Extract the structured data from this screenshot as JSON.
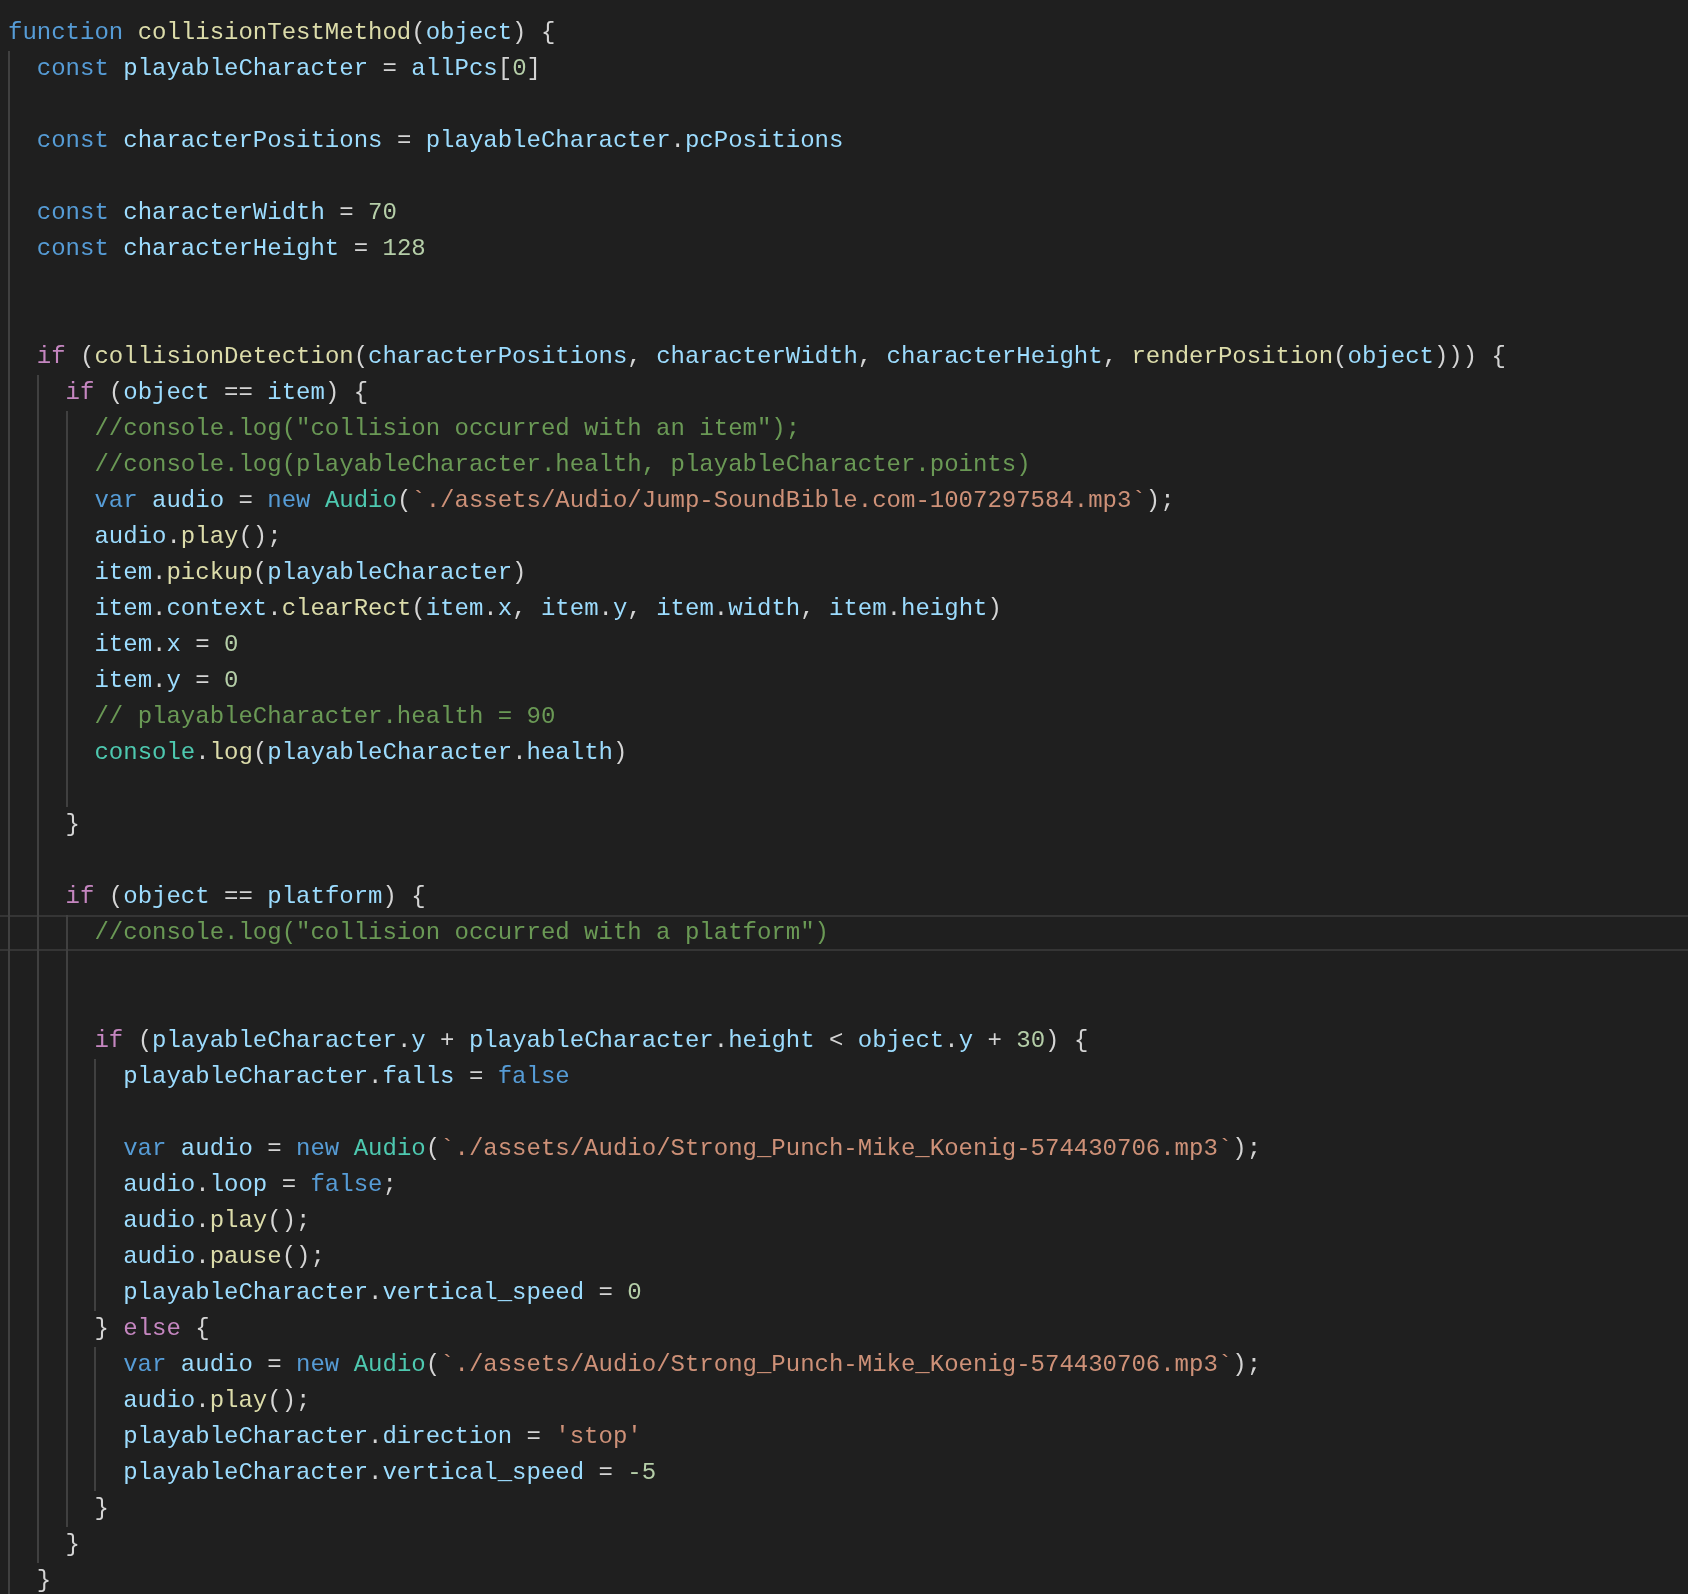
{
  "editor": {
    "lines": [
      {
        "current": false,
        "tokens": [
          {
            "kind": "keyword",
            "text": "function "
          },
          {
            "kind": "function",
            "text": "collisionTestMethod"
          },
          {
            "kind": "punctuation",
            "text": "("
          },
          {
            "kind": "variable",
            "text": "object"
          },
          {
            "kind": "punctuation",
            "text": ") {"
          }
        ]
      },
      {
        "current": false,
        "tokens": [
          {
            "kind": "keyword",
            "text": "  const "
          },
          {
            "kind": "variable",
            "text": "playableCharacter"
          },
          {
            "kind": "punctuation",
            "text": " = "
          },
          {
            "kind": "variable",
            "text": "allPcs"
          },
          {
            "kind": "punctuation",
            "text": "["
          },
          {
            "kind": "number",
            "text": "0"
          },
          {
            "kind": "punctuation",
            "text": "]"
          }
        ]
      },
      {
        "current": false
      },
      {
        "current": false,
        "tokens": [
          {
            "kind": "keyword",
            "text": "  const "
          },
          {
            "kind": "variable",
            "text": "characterPositions"
          },
          {
            "kind": "punctuation",
            "text": " = "
          },
          {
            "kind": "variable",
            "text": "playableCharacter"
          },
          {
            "kind": "punctuation",
            "text": "."
          },
          {
            "kind": "variable",
            "text": "pcPositions"
          }
        ]
      },
      {
        "current": false
      },
      {
        "current": false,
        "tokens": [
          {
            "kind": "keyword",
            "text": "  const "
          },
          {
            "kind": "variable",
            "text": "characterWidth"
          },
          {
            "kind": "punctuation",
            "text": " = "
          },
          {
            "kind": "number",
            "text": "70"
          }
        ]
      },
      {
        "current": false,
        "tokens": [
          {
            "kind": "keyword",
            "text": "  const "
          },
          {
            "kind": "variable",
            "text": "characterHeight"
          },
          {
            "kind": "punctuation",
            "text": " = "
          },
          {
            "kind": "number",
            "text": "128"
          }
        ]
      },
      {
        "current": false
      },
      {
        "current": false
      },
      {
        "current": false,
        "tokens": [
          {
            "kind": "control",
            "text": "  if"
          },
          {
            "kind": "punctuation",
            "text": " ("
          },
          {
            "kind": "function",
            "text": "collisionDetection"
          },
          {
            "kind": "punctuation",
            "text": "("
          },
          {
            "kind": "variable",
            "text": "characterPositions"
          },
          {
            "kind": "punctuation",
            "text": ", "
          },
          {
            "kind": "variable",
            "text": "characterWidth"
          },
          {
            "kind": "punctuation",
            "text": ", "
          },
          {
            "kind": "variable",
            "text": "characterHeight"
          },
          {
            "kind": "punctuation",
            "text": ", "
          },
          {
            "kind": "function",
            "text": "renderPosition"
          },
          {
            "kind": "punctuation",
            "text": "("
          },
          {
            "kind": "variable",
            "text": "object"
          },
          {
            "kind": "punctuation",
            "text": "))) {"
          }
        ]
      },
      {
        "current": false,
        "tokens": [
          {
            "kind": "control",
            "text": "    if"
          },
          {
            "kind": "punctuation",
            "text": " ("
          },
          {
            "kind": "variable",
            "text": "object"
          },
          {
            "kind": "punctuation",
            "text": " == "
          },
          {
            "kind": "variable",
            "text": "item"
          },
          {
            "kind": "punctuation",
            "text": ") {"
          }
        ]
      },
      {
        "current": false,
        "tokens": [
          {
            "kind": "comment",
            "text": "      //console.log(\"collision occurred with an item\");"
          }
        ]
      },
      {
        "current": false,
        "tokens": [
          {
            "kind": "comment",
            "text": "      //console.log(playableCharacter.health, playableCharacter.points)"
          }
        ]
      },
      {
        "current": false,
        "tokens": [
          {
            "kind": "keyword",
            "text": "      var "
          },
          {
            "kind": "variable",
            "text": "audio"
          },
          {
            "kind": "punctuation",
            "text": " = "
          },
          {
            "kind": "keyword",
            "text": "new "
          },
          {
            "kind": "class",
            "text": "Audio"
          },
          {
            "kind": "punctuation",
            "text": "("
          },
          {
            "kind": "string",
            "text": "`./assets/Audio/Jump-SoundBible.com-1007297584.mp3`"
          },
          {
            "kind": "punctuation",
            "text": ");"
          }
        ]
      },
      {
        "current": false,
        "tokens": [
          {
            "kind": "variable",
            "text": "      audio"
          },
          {
            "kind": "punctuation",
            "text": "."
          },
          {
            "kind": "function",
            "text": "play"
          },
          {
            "kind": "punctuation",
            "text": "();"
          }
        ]
      },
      {
        "current": false,
        "tokens": [
          {
            "kind": "variable",
            "text": "      item"
          },
          {
            "kind": "punctuation",
            "text": "."
          },
          {
            "kind": "function",
            "text": "pickup"
          },
          {
            "kind": "punctuation",
            "text": "("
          },
          {
            "kind": "variable",
            "text": "playableCharacter"
          },
          {
            "kind": "punctuation",
            "text": ")"
          }
        ]
      },
      {
        "current": false,
        "tokens": [
          {
            "kind": "variable",
            "text": "      item"
          },
          {
            "kind": "punctuation",
            "text": "."
          },
          {
            "kind": "variable",
            "text": "context"
          },
          {
            "kind": "punctuation",
            "text": "."
          },
          {
            "kind": "function",
            "text": "clearRect"
          },
          {
            "kind": "punctuation",
            "text": "("
          },
          {
            "kind": "variable",
            "text": "item"
          },
          {
            "kind": "punctuation",
            "text": "."
          },
          {
            "kind": "variable",
            "text": "x"
          },
          {
            "kind": "punctuation",
            "text": ", "
          },
          {
            "kind": "variable",
            "text": "item"
          },
          {
            "kind": "punctuation",
            "text": "."
          },
          {
            "kind": "variable",
            "text": "y"
          },
          {
            "kind": "punctuation",
            "text": ", "
          },
          {
            "kind": "variable",
            "text": "item"
          },
          {
            "kind": "punctuation",
            "text": "."
          },
          {
            "kind": "variable",
            "text": "width"
          },
          {
            "kind": "punctuation",
            "text": ", "
          },
          {
            "kind": "variable",
            "text": "item"
          },
          {
            "kind": "punctuation",
            "text": "."
          },
          {
            "kind": "variable",
            "text": "height"
          },
          {
            "kind": "punctuation",
            "text": ")"
          }
        ]
      },
      {
        "current": false,
        "tokens": [
          {
            "kind": "variable",
            "text": "      item"
          },
          {
            "kind": "punctuation",
            "text": "."
          },
          {
            "kind": "variable",
            "text": "x"
          },
          {
            "kind": "punctuation",
            "text": " = "
          },
          {
            "kind": "number",
            "text": "0"
          }
        ]
      },
      {
        "current": false,
        "tokens": [
          {
            "kind": "variable",
            "text": "      item"
          },
          {
            "kind": "punctuation",
            "text": "."
          },
          {
            "kind": "variable",
            "text": "y"
          },
          {
            "kind": "punctuation",
            "text": " = "
          },
          {
            "kind": "number",
            "text": "0"
          }
        ]
      },
      {
        "current": false,
        "tokens": [
          {
            "kind": "comment",
            "text": "      // playableCharacter.health = 90"
          }
        ]
      },
      {
        "current": false,
        "tokens": [
          {
            "kind": "class",
            "text": "      console"
          },
          {
            "kind": "punctuation",
            "text": "."
          },
          {
            "kind": "function",
            "text": "log"
          },
          {
            "kind": "punctuation",
            "text": "("
          },
          {
            "kind": "variable",
            "text": "playableCharacter"
          },
          {
            "kind": "punctuation",
            "text": "."
          },
          {
            "kind": "variable",
            "text": "health"
          },
          {
            "kind": "punctuation",
            "text": ")"
          }
        ]
      },
      {
        "current": false
      },
      {
        "current": false,
        "tokens": [
          {
            "kind": "punctuation",
            "text": "    }"
          }
        ]
      },
      {
        "current": false
      },
      {
        "current": false,
        "tokens": [
          {
            "kind": "control",
            "text": "    if"
          },
          {
            "kind": "punctuation",
            "text": " ("
          },
          {
            "kind": "variable",
            "text": "object"
          },
          {
            "kind": "punctuation",
            "text": " == "
          },
          {
            "kind": "variable",
            "text": "platform"
          },
          {
            "kind": "punctuation",
            "text": ") {"
          }
        ]
      },
      {
        "current": true,
        "tokens": [
          {
            "kind": "comment",
            "text": "      //console.log(\"collision occurred with a platform\")"
          }
        ]
      },
      {
        "current": false
      },
      {
        "current": false
      },
      {
        "current": false,
        "tokens": [
          {
            "kind": "control",
            "text": "      if"
          },
          {
            "kind": "punctuation",
            "text": " ("
          },
          {
            "kind": "variable",
            "text": "playableCharacter"
          },
          {
            "kind": "punctuation",
            "text": "."
          },
          {
            "kind": "variable",
            "text": "y"
          },
          {
            "kind": "punctuation",
            "text": " + "
          },
          {
            "kind": "variable",
            "text": "playableCharacter"
          },
          {
            "kind": "punctuation",
            "text": "."
          },
          {
            "kind": "variable",
            "text": "height"
          },
          {
            "kind": "punctuation",
            "text": " < "
          },
          {
            "kind": "variable",
            "text": "object"
          },
          {
            "kind": "punctuation",
            "text": "."
          },
          {
            "kind": "variable",
            "text": "y"
          },
          {
            "kind": "punctuation",
            "text": " + "
          },
          {
            "kind": "number",
            "text": "30"
          },
          {
            "kind": "punctuation",
            "text": ") {"
          }
        ]
      },
      {
        "current": false,
        "tokens": [
          {
            "kind": "variable",
            "text": "        playableCharacter"
          },
          {
            "kind": "punctuation",
            "text": "."
          },
          {
            "kind": "variable",
            "text": "falls"
          },
          {
            "kind": "punctuation",
            "text": " = "
          },
          {
            "kind": "keyword",
            "text": "false"
          }
        ]
      },
      {
        "current": false
      },
      {
        "current": false,
        "tokens": [
          {
            "kind": "keyword",
            "text": "        var "
          },
          {
            "kind": "variable",
            "text": "audio"
          },
          {
            "kind": "punctuation",
            "text": " = "
          },
          {
            "kind": "keyword",
            "text": "new "
          },
          {
            "kind": "class",
            "text": "Audio"
          },
          {
            "kind": "punctuation",
            "text": "("
          },
          {
            "kind": "string",
            "text": "`./assets/Audio/Strong_Punch-Mike_Koenig-574430706.mp3`"
          },
          {
            "kind": "punctuation",
            "text": ");"
          }
        ]
      },
      {
        "current": false,
        "tokens": [
          {
            "kind": "variable",
            "text": "        audio"
          },
          {
            "kind": "punctuation",
            "text": "."
          },
          {
            "kind": "variable",
            "text": "loop"
          },
          {
            "kind": "punctuation",
            "text": " = "
          },
          {
            "kind": "keyword",
            "text": "false"
          },
          {
            "kind": "punctuation",
            "text": ";"
          }
        ]
      },
      {
        "current": false,
        "tokens": [
          {
            "kind": "variable",
            "text": "        audio"
          },
          {
            "kind": "punctuation",
            "text": "."
          },
          {
            "kind": "function",
            "text": "play"
          },
          {
            "kind": "punctuation",
            "text": "();"
          }
        ]
      },
      {
        "current": false,
        "tokens": [
          {
            "kind": "variable",
            "text": "        audio"
          },
          {
            "kind": "punctuation",
            "text": "."
          },
          {
            "kind": "function",
            "text": "pause"
          },
          {
            "kind": "punctuation",
            "text": "();"
          }
        ]
      },
      {
        "current": false,
        "tokens": [
          {
            "kind": "variable",
            "text": "        playableCharacter"
          },
          {
            "kind": "punctuation",
            "text": "."
          },
          {
            "kind": "variable",
            "text": "vertical_speed"
          },
          {
            "kind": "punctuation",
            "text": " = "
          },
          {
            "kind": "number",
            "text": "0"
          }
        ]
      },
      {
        "current": false,
        "tokens": [
          {
            "kind": "punctuation",
            "text": "      } "
          },
          {
            "kind": "control",
            "text": "else"
          },
          {
            "kind": "punctuation",
            "text": " {"
          }
        ]
      },
      {
        "current": false,
        "tokens": [
          {
            "kind": "keyword",
            "text": "        var "
          },
          {
            "kind": "variable",
            "text": "audio"
          },
          {
            "kind": "punctuation",
            "text": " = "
          },
          {
            "kind": "keyword",
            "text": "new "
          },
          {
            "kind": "class",
            "text": "Audio"
          },
          {
            "kind": "punctuation",
            "text": "("
          },
          {
            "kind": "string",
            "text": "`./assets/Audio/Strong_Punch-Mike_Koenig-574430706.mp3`"
          },
          {
            "kind": "punctuation",
            "text": ");"
          }
        ]
      },
      {
        "current": false,
        "tokens": [
          {
            "kind": "variable",
            "text": "        audio"
          },
          {
            "kind": "punctuation",
            "text": "."
          },
          {
            "kind": "function",
            "text": "play"
          },
          {
            "kind": "punctuation",
            "text": "();"
          }
        ]
      },
      {
        "current": false,
        "tokens": [
          {
            "kind": "variable",
            "text": "        playableCharacter"
          },
          {
            "kind": "punctuation",
            "text": "."
          },
          {
            "kind": "variable",
            "text": "direction"
          },
          {
            "kind": "punctuation",
            "text": " = "
          },
          {
            "kind": "string",
            "text": "'stop'"
          }
        ]
      },
      {
        "current": false,
        "tokens": [
          {
            "kind": "variable",
            "text": "        playableCharacter"
          },
          {
            "kind": "punctuation",
            "text": "."
          },
          {
            "kind": "variable",
            "text": "vertical_speed"
          },
          {
            "kind": "punctuation",
            "text": " = "
          },
          {
            "kind": "number",
            "text": "-5"
          }
        ]
      },
      {
        "current": false,
        "tokens": [
          {
            "kind": "punctuation",
            "text": "      }"
          }
        ]
      },
      {
        "current": false,
        "tokens": [
          {
            "kind": "punctuation",
            "text": "    }"
          }
        ]
      },
      {
        "current": false,
        "tokens": [
          {
            "kind": "punctuation",
            "text": "  }"
          }
        ]
      }
    ]
  }
}
